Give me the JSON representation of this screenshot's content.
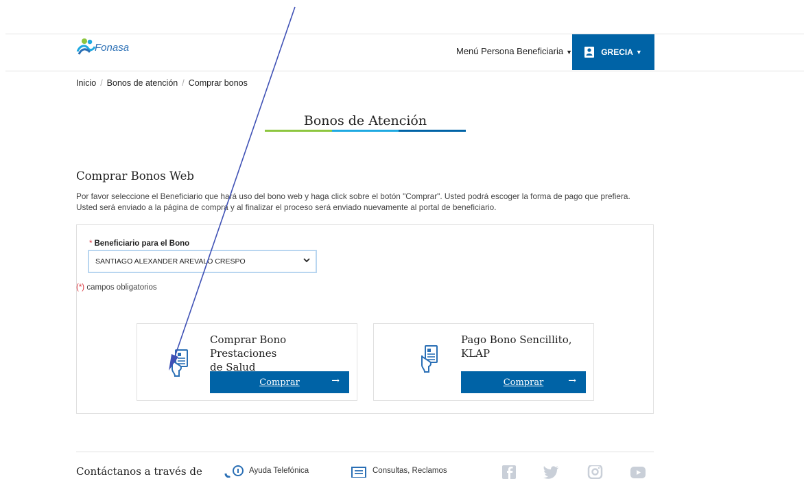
{
  "header": {
    "logo_text": "Fonasa",
    "menu_label": "Menú Persona Beneficiaria",
    "user_label": "GRECIA"
  },
  "breadcrumb": {
    "items": [
      "Inicio",
      "Bonos de atención",
      "Comprar bonos"
    ]
  },
  "page": {
    "title": "Bonos de Atención",
    "title_bar_colors": [
      "#8dc63f",
      "#1fa9e1",
      "#0063a6"
    ]
  },
  "section": {
    "title": "Comprar Bonos Web",
    "description_line1": "Por favor seleccione el Beneficiario que hará uso del bono web y haga click sobre el botón \"Comprar\". Usted podrá escoger la forma de pago que prefiera.",
    "description_line2": "Usted será enviado a la página de compra y al finalizar el proceso será enviado nuevamente al portal de beneficiario."
  },
  "form": {
    "required_mark": "*",
    "field_label": "Beneficiario para el Bono",
    "selected_value": "SANTIAGO ALEXANDER AREVALO CRESPO",
    "required_note_mark": "(*)",
    "required_note": "campos obligatorios"
  },
  "cards": [
    {
      "title_line1": "Comprar Bono Prestaciones",
      "title_line2": "de Salud",
      "button_label": "Comprar",
      "arrow": "→"
    },
    {
      "title_line1": "Pago Bono Sencillito,",
      "title_line2": "KLAP",
      "button_label": "Comprar",
      "arrow": "→"
    }
  ],
  "footer": {
    "contact_label": "Contáctanos a través de",
    "phone_help": "Ayuda Telefónica",
    "consult_label": "Consultas, Reclamos",
    "social_icons": [
      "facebook-icon",
      "twitter-icon",
      "instagram-icon",
      "youtube-icon"
    ]
  },
  "colors": {
    "brand_blue": "#0063a6",
    "icon_blue": "#2a6fb5",
    "required_red": "#d9363e",
    "annotation_arrow": "#3f51b5"
  }
}
